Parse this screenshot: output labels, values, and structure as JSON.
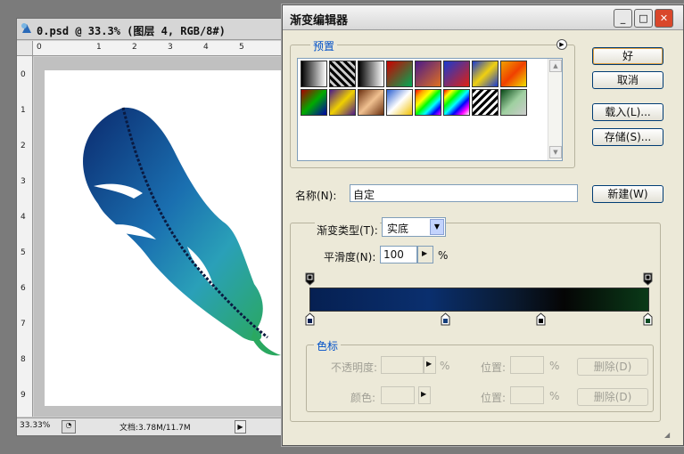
{
  "doc": {
    "title": "0.psd @ 33.3% (图层 4, RGB/8#)",
    "ruler_h": [
      "0",
      "1",
      "2",
      "3",
      "4",
      "5"
    ],
    "ruler_v": [
      "0",
      "1",
      "2",
      "3",
      "4",
      "5",
      "6",
      "7",
      "8",
      "9"
    ],
    "zoom": "33.33%",
    "doc_info": "文档:3.78M/11.7M",
    "arrow": "▶"
  },
  "dialog": {
    "title": "渐变编辑器",
    "presets_legend": "预置",
    "ok": "好",
    "cancel": "取消",
    "load": "载入(L)...",
    "save": "存储(S)...",
    "name_label": "名称(N):",
    "name_value": "自定",
    "new_button": "新建(W)",
    "type_label": "渐变类型(T):",
    "type_value": "实底",
    "smooth_label": "平滑度(N):",
    "smooth_value": "100",
    "percent": "%",
    "stops_legend": "色标",
    "opacity_label": "不透明度:",
    "position_label": "位置:",
    "delete_label": "删除(D)",
    "color_label": "颜色:"
  },
  "colors": {
    "stop1": "#0a1f52",
    "stop2": "#143d7a",
    "stop3": "#000000",
    "stop4": "#0b4a22"
  }
}
